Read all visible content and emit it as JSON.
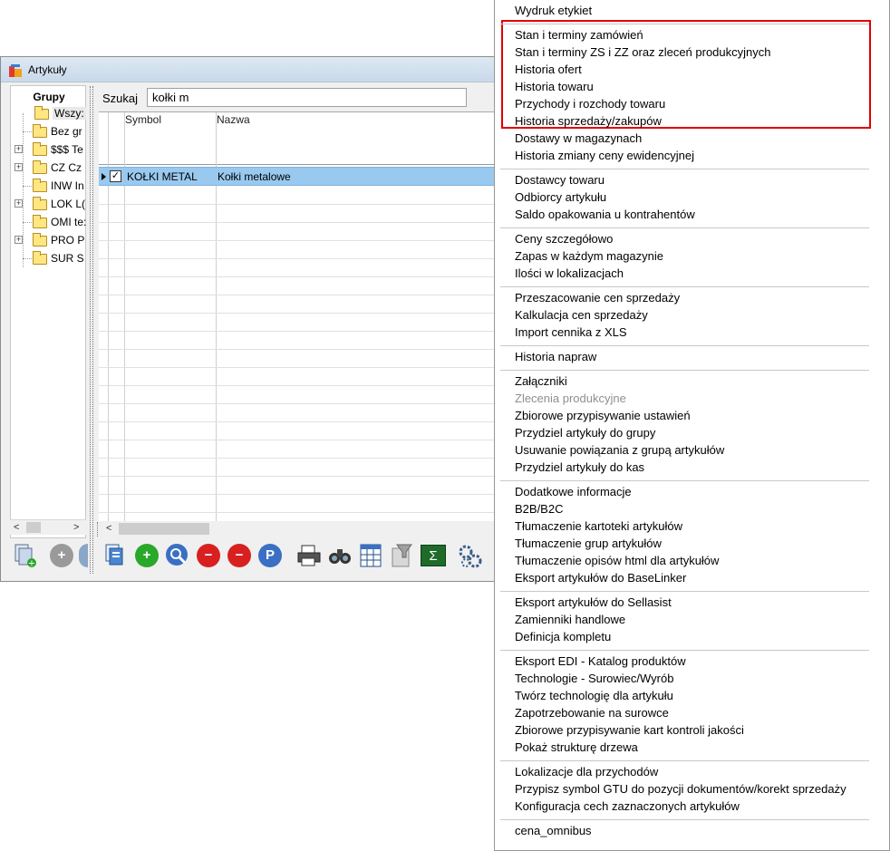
{
  "window": {
    "title": "Artykuły",
    "groups_header": "Grupy",
    "tree": [
      {
        "label": "Wszy:"
      },
      {
        "label": "Bez gr"
      },
      {
        "label": "$$$ Te"
      },
      {
        "label": "CZ  Cz"
      },
      {
        "label": "INW In"
      },
      {
        "label": "LOK L("
      },
      {
        "label": "OMI te:"
      },
      {
        "label": "PRO P"
      },
      {
        "label": "SUR S"
      }
    ],
    "search": {
      "label": "Szukaj",
      "value": "kołki m"
    },
    "columns": [
      "Symbol",
      "Nazwa"
    ],
    "rows": [
      {
        "symbol": "KOŁKI METAL",
        "name": "Kołki metalowe",
        "checked": true
      }
    ],
    "scroll_left": "<",
    "scroll_right": ">",
    "toolbar_icons": [
      "new-document-icon",
      "add-icon",
      "search-icon",
      "remove-icon",
      "remove-check-icon",
      "park-icon",
      "print-icon",
      "binoculars-icon",
      "table-icon",
      "filter-icon",
      "sum-icon",
      "settings-icon"
    ],
    "toolbar_glyphs": {
      "add": "+",
      "remove": "−",
      "park": "P",
      "sum": "Σ"
    }
  },
  "context_menu": {
    "groups": [
      [
        "Wydruk etykiet"
      ],
      [
        "Stan i terminy zamówień",
        "Stan i terminy ZS i ZZ oraz zleceń produkcyjnych",
        "Historia  ofert",
        "Historia towaru",
        "Przychody i rozchody towaru",
        "Historia sprzedaży/zakupów",
        "Dostawy w magazynach",
        "Historia zmiany ceny ewidencyjnej"
      ],
      [
        "Dostawcy towaru",
        "Odbiorcy artykułu",
        "Saldo opakowania u kontrahentów"
      ],
      [
        "Ceny szczegółowo",
        "Zapas w każdym magazynie",
        "Ilości w lokalizacjach"
      ],
      [
        "Przeszacowanie cen sprzedaży",
        "Kalkulacja cen sprzedaży",
        "Import cennika z XLS"
      ],
      [
        "Historia napraw"
      ],
      [
        "Załączniki",
        "Zlecenia produkcyjne",
        "Zbiorowe przypisywanie ustawień",
        "Przydziel artykuły do grupy",
        "Usuwanie powiązania z grupą artykułów",
        "Przydziel artykuły do kas"
      ],
      [
        "Dodatkowe informacje",
        "B2B/B2C",
        "Tłumaczenie kartoteki artykułów",
        "Tłumaczenie grup artykułów",
        "Tłumaczenie opisów html dla artykułów",
        "Eksport artykułów do BaseLinker"
      ],
      [
        "Eksport artykułów do Sellasist",
        "Zamienniki handlowe",
        "Definicja kompletu"
      ],
      [
        "Eksport EDI - Katalog produktów",
        "Technologie - Surowiec/Wyrób",
        "Twórz technologię dla artykułu",
        "Zapotrzebowanie na surowce",
        "Zbiorowe przypisywanie kart kontroli jakości",
        "Pokaż strukturę drzewa"
      ],
      [
        "Lokalizacje dla przychodów",
        "Przypisz symbol GTU do pozycji dokumentów/korekt sprzedaży",
        "Konfiguracja cech zaznaczonych artykułów"
      ],
      [
        "cena_omnibus"
      ]
    ],
    "disabled_items": [
      "Zlecenia produkcyjne"
    ],
    "highlight_color": "#e00000"
  }
}
